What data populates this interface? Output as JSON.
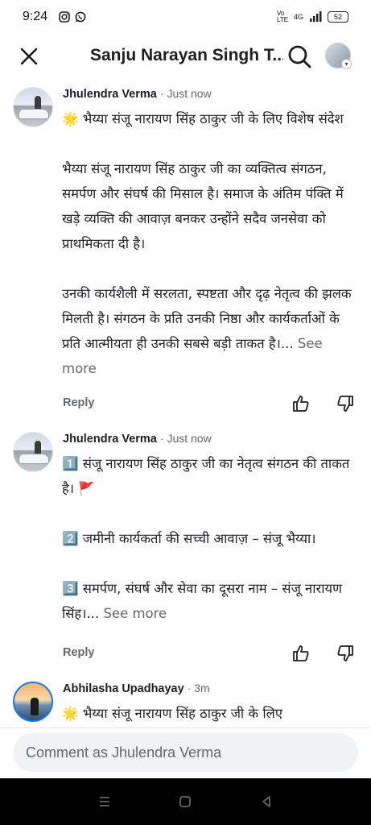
{
  "status": {
    "time": "9:24",
    "network": "Vo LTE",
    "signal": "4G",
    "battery": "52"
  },
  "header": {
    "title": "Sanju Narayan Singh T..."
  },
  "comments": [
    {
      "author": "Jhulendra Verma",
      "time": "· Just now",
      "text": "🌟 भैय्या संजू नारायण सिंह ठाकुर जी के लिए विशेष संदेश\n\nभैय्या संजू नारायण सिंह ठाकुर जी का व्यक्तित्व संगठन, समर्पण और संघर्ष की मिसाल है। समाज के अंतिम पंक्ति में खड़े व्यक्ति की आवाज़ बनकर उन्होंने सदैव जनसेवा को प्राथमिकता दी है।\n\nउनकी कार्यशैली में सरलता, स्पष्टता और दृढ़ नेतृत्व की झलक मिलती है। संगठन के प्रति उनकी निष्ठा और कार्यकर्ताओं के प्रति आत्मीयता ही उनकी सबसे बड़ी ताकत है।...",
      "see_more": "See more",
      "reply": "Reply"
    },
    {
      "author": "Jhulendra Verma",
      "time": "· Just now",
      "text": "1️⃣ संजू नारायण सिंह ठाकुर जी का नेतृत्व संगठन की ताकत है। 🚩\n\n2️⃣ जमीनी कार्यकर्ता की सच्ची आवाज़ – संजू भैय्या।\n\n3️⃣ समर्पण, संघर्ष और सेवा का दूसरा नाम – संजू नारायण सिंह।...",
      "see_more": "See more",
      "reply": "Reply"
    },
    {
      "author": "Abhilasha Upadhayay",
      "time": "· 3m",
      "text": "🌟 भैय्या संजू नारायण सिंह ठाकुर जी के लिए"
    }
  ],
  "composer": {
    "placeholder": "Comment as Jhulendra Verma"
  }
}
